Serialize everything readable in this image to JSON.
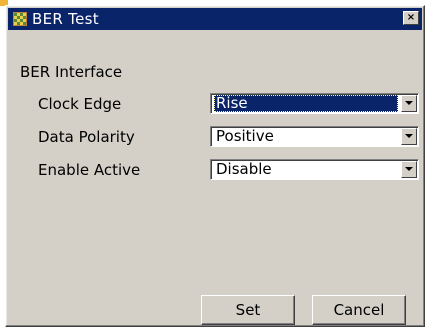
{
  "window": {
    "title": "BER Test",
    "close_symbol": "×",
    "icon": "app-icon"
  },
  "section": {
    "heading": "BER Interface"
  },
  "fields": [
    {
      "label": "Clock Edge",
      "value": "Rise",
      "focused": true
    },
    {
      "label": "Data Polarity",
      "value": "Positive",
      "focused": false
    },
    {
      "label": "Enable Active",
      "value": "Disable",
      "focused": false
    }
  ],
  "buttons": {
    "set_label": "Set",
    "cancel_label": "Cancel"
  },
  "colors": {
    "titlebar": "#0a246a",
    "dialog_face": "#d4d0c8",
    "selection": "#0a246a"
  }
}
